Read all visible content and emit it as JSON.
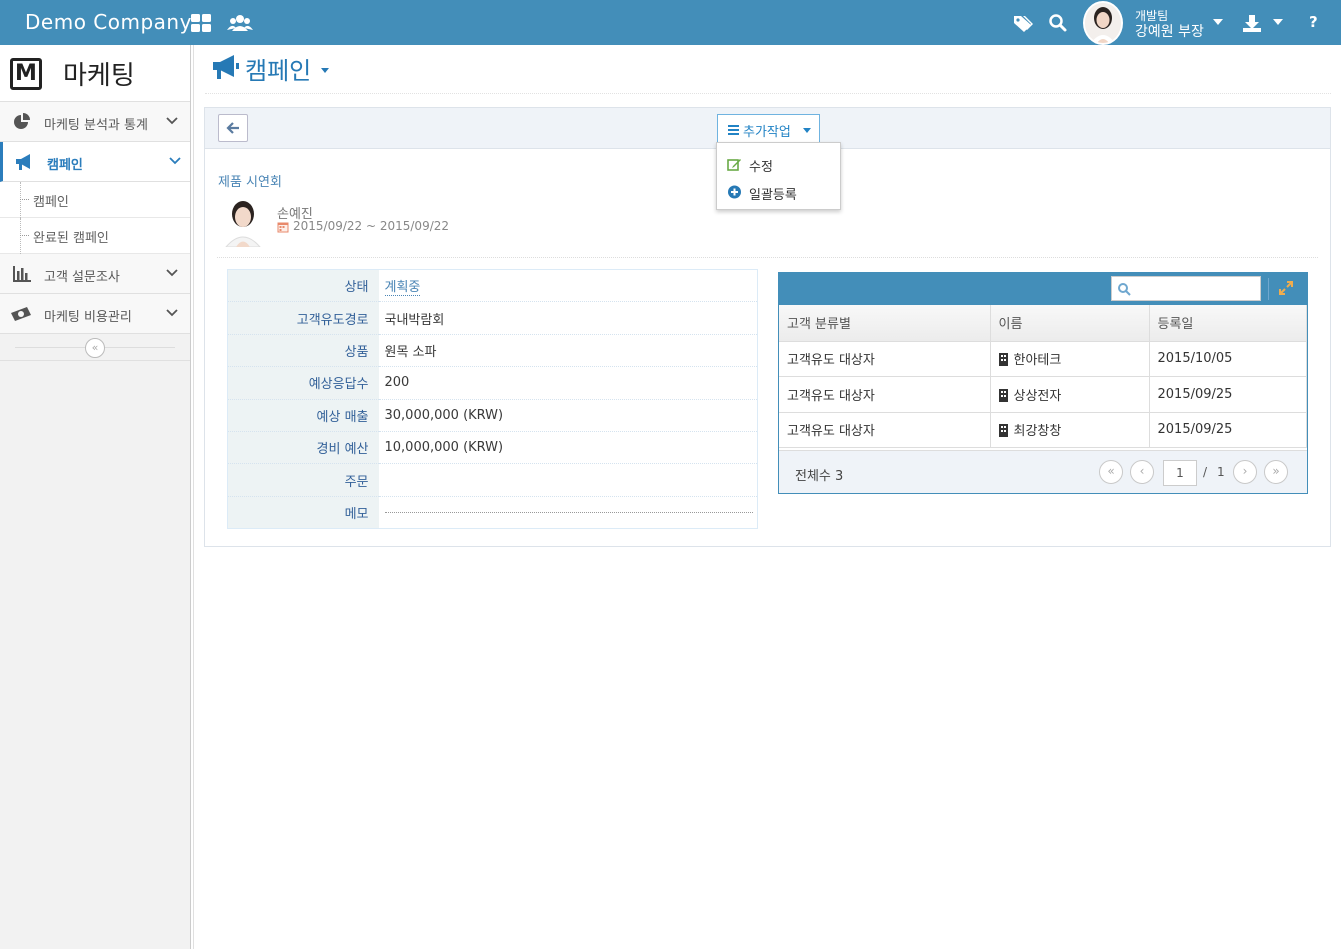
{
  "topbar": {
    "brand": "Demo Company",
    "user_team": "개발팀",
    "user_name": "강예원 부장",
    "icons": [
      "apps-grid-icon",
      "users-icon",
      "tags-icon",
      "search-icon",
      "download-icon",
      "help-icon"
    ],
    "help_label": "?"
  },
  "sidebar": {
    "logo_letter": "M",
    "logo_text": "마케팅",
    "items": [
      {
        "label": "마케팅 분석과 통계",
        "icon": "pie-chart-icon"
      },
      {
        "label": "캠페인",
        "icon": "megaphone-icon",
        "active": true
      },
      {
        "label": "고객 설문조사",
        "icon": "bar-chart-icon"
      },
      {
        "label": "마케팅 비용관리",
        "icon": "money-icon"
      }
    ],
    "sub_items": [
      {
        "label": "캠페인"
      },
      {
        "label": "완료된 캠페인"
      }
    ],
    "collapse_label": "«"
  },
  "page": {
    "title": "캠페인"
  },
  "toolbar": {
    "more_label": "추가작업",
    "dropdown": [
      {
        "label": "수정",
        "icon": "edit-icon"
      },
      {
        "label": "일괄등록",
        "icon": "plus-circle-icon"
      }
    ]
  },
  "campaign": {
    "name": "제품 시연회",
    "owner": "손예진",
    "date_range": "2015/09/22 ~ 2015/09/22"
  },
  "details": [
    {
      "key": "상태",
      "value": "계획중",
      "link": true
    },
    {
      "key": "고객유도경로",
      "value": "국내박람회"
    },
    {
      "key": "상품",
      "value": "원목 소파"
    },
    {
      "key": "예상응답수",
      "value": "200"
    },
    {
      "key": "예상 매출",
      "value": "30,000,000 (KRW)"
    },
    {
      "key": "경비 예산",
      "value": "10,000,000 (KRW)"
    },
    {
      "key": "주문",
      "value": ""
    },
    {
      "key": "메모",
      "value": ""
    }
  ],
  "grid": {
    "columns": [
      "고객 분류별",
      "이름",
      "등록일"
    ],
    "rows": [
      [
        "고객유도 대상자",
        "한아테크",
        "2015/10/05"
      ],
      [
        "고객유도 대상자",
        "상상전자",
        "2015/09/25"
      ],
      [
        "고객유도 대상자",
        "최강창창",
        "2015/09/25"
      ]
    ],
    "total_label": "전체수 3",
    "page_current": "1",
    "page_sep": "/",
    "page_total": "1",
    "pager_first": "«",
    "pager_prev": "‹",
    "pager_next": "›",
    "pager_last": "»"
  }
}
